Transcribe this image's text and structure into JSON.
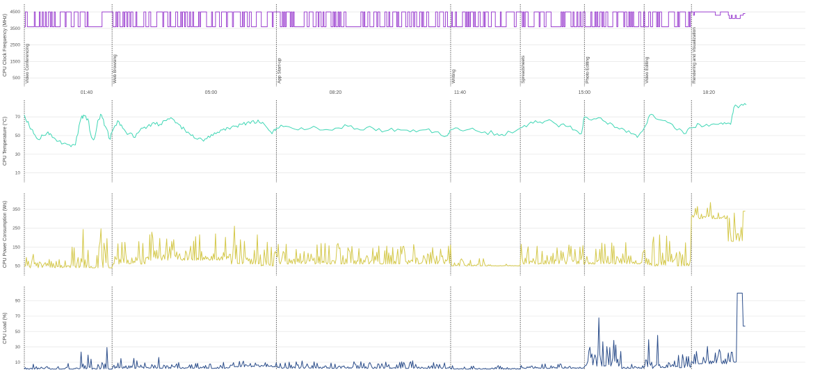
{
  "chart_data": [
    {
      "type": "line",
      "ylabel": "CPU Clock Frequency (MHz)",
      "yticks": [
        500,
        1500,
        2500,
        3500,
        4500
      ],
      "ylim": [
        0,
        4800
      ],
      "xlim": [
        0,
        1255
      ],
      "xticks": [
        {
          "t": 100,
          "label": "01:40"
        },
        {
          "t": 300,
          "label": "05:00"
        },
        {
          "t": 500,
          "label": "08:20"
        },
        {
          "t": 700,
          "label": "11:40"
        },
        {
          "t": 900,
          "label": "15:00"
        },
        {
          "t": 1100,
          "label": "18:20"
        }
      ],
      "phases": [
        {
          "t": 0,
          "label": "Video Conferencing"
        },
        {
          "t": 141,
          "label": "Web Browsing"
        },
        {
          "t": 405,
          "label": "App Start-up"
        },
        {
          "t": 685,
          "label": "Writing"
        },
        {
          "t": 797,
          "label": "Spreadsheets"
        },
        {
          "t": 900,
          "label": "Photo Editing"
        },
        {
          "t": 996,
          "label": "Video Editing"
        },
        {
          "t": 1072,
          "label": "Rendering and Visualization"
        }
      ],
      "color": "#9b3fcf",
      "series": [
        {
          "profile": [
            [
              0,
              3600,
              4500,
              0.85
            ],
            [
              100,
              4500,
              4500,
              0
            ],
            [
              102,
              3600,
              3600,
              0
            ],
            [
              124,
              4500,
              4500,
              0
            ],
            [
              141,
              3600,
              4500,
              0.8
            ],
            [
              405,
              3600,
              4500,
              0.85
            ],
            [
              685,
              3600,
              4500,
              0.75
            ],
            [
              797,
              3600,
              4500,
              0.8
            ],
            [
              900,
              3600,
              4500,
              0.85
            ],
            [
              996,
              3600,
              4500,
              0.8
            ],
            [
              1072,
              4300,
              4500,
              0.5
            ],
            [
              1130,
              4100,
              4300,
              0.6
            ],
            [
              1160,
              4300,
              4400,
              0.3
            ],
            [
              1155,
              4300,
              4400,
              0
            ]
          ]
        }
      ]
    },
    {
      "type": "line",
      "ylabel": "CPU Temperature (°C)",
      "yticks": [
        10,
        30,
        50,
        70
      ],
      "ylim": [
        0,
        85
      ],
      "xlim": [
        0,
        1255
      ],
      "color": "#3ed6b4",
      "series": [
        {
          "points": [
            [
              0,
              72
            ],
            [
              8,
              60
            ],
            [
              15,
              52
            ],
            [
              22,
              46
            ],
            [
              30,
              50
            ],
            [
              38,
              54
            ],
            [
              45,
              48
            ],
            [
              55,
              44
            ],
            [
              65,
              42
            ],
            [
              75,
              38
            ],
            [
              82,
              40
            ],
            [
              90,
              66
            ],
            [
              95,
              72
            ],
            [
              102,
              68
            ],
            [
              108,
              48
            ],
            [
              112,
              46
            ],
            [
              118,
              66
            ],
            [
              124,
              72
            ],
            [
              130,
              60
            ],
            [
              138,
              46
            ],
            [
              141,
              54
            ],
            [
              150,
              66
            ],
            [
              158,
              58
            ],
            [
              168,
              52
            ],
            [
              178,
              48
            ],
            [
              188,
              58
            ],
            [
              198,
              60
            ],
            [
              208,
              64
            ],
            [
              218,
              62
            ],
            [
              228,
              66
            ],
            [
              238,
              68
            ],
            [
              248,
              62
            ],
            [
              258,
              56
            ],
            [
              268,
              50
            ],
            [
              278,
              46
            ],
            [
              288,
              44
            ],
            [
              298,
              48
            ],
            [
              308,
              52
            ],
            [
              318,
              56
            ],
            [
              328,
              58
            ],
            [
              338,
              60
            ],
            [
              348,
              62
            ],
            [
              358,
              64
            ],
            [
              368,
              66
            ],
            [
              378,
              64
            ],
            [
              388,
              60
            ],
            [
              398,
              52
            ],
            [
              405,
              58
            ],
            [
              420,
              60
            ],
            [
              440,
              56
            ],
            [
              460,
              58
            ],
            [
              480,
              56
            ],
            [
              500,
              58
            ],
            [
              520,
              60
            ],
            [
              540,
              56
            ],
            [
              560,
              58
            ],
            [
              580,
              55
            ],
            [
              600,
              57
            ],
            [
              620,
              54
            ],
            [
              640,
              56
            ],
            [
              660,
              54
            ],
            [
              680,
              50
            ],
            [
              685,
              56
            ],
            [
              700,
              56
            ],
            [
              720,
              58
            ],
            [
              740,
              54
            ],
            [
              760,
              52
            ],
            [
              770,
              50
            ],
            [
              780,
              54
            ],
            [
              797,
              58
            ],
            [
              810,
              62
            ],
            [
              825,
              64
            ],
            [
              840,
              66
            ],
            [
              855,
              62
            ],
            [
              870,
              60
            ],
            [
              885,
              56
            ],
            [
              895,
              52
            ],
            [
              900,
              70
            ],
            [
              915,
              68
            ],
            [
              930,
              66
            ],
            [
              945,
              62
            ],
            [
              960,
              58
            ],
            [
              975,
              52
            ],
            [
              985,
              48
            ],
            [
              996,
              58
            ],
            [
              1005,
              72
            ],
            [
              1015,
              68
            ],
            [
              1030,
              66
            ],
            [
              1045,
              58
            ],
            [
              1060,
              52
            ],
            [
              1072,
              58
            ],
            [
              1085,
              62
            ],
            [
              1100,
              60
            ],
            [
              1115,
              62
            ],
            [
              1125,
              64
            ],
            [
              1135,
              62
            ],
            [
              1140,
              80
            ],
            [
              1150,
              82
            ],
            [
              1160,
              83
            ]
          ]
        }
      ]
    },
    {
      "type": "line",
      "ylabel": "CPU Power Consumption (Ws)",
      "yticks": [
        50,
        150,
        250,
        350
      ],
      "ylim": [
        0,
        420
      ],
      "xlim": [
        0,
        1255
      ],
      "color": "#d4c84a",
      "series": [
        {
          "profile": [
            [
              0,
              40,
              160,
              0.4
            ],
            [
              85,
              40,
              250,
              0.5
            ],
            [
              110,
              40,
              40,
              0
            ],
            [
              115,
              40,
              250,
              0.5
            ],
            [
              135,
              40,
              40,
              0
            ],
            [
              141,
              60,
              200,
              0.6
            ],
            [
              200,
              80,
              230,
              0.7
            ],
            [
              330,
              60,
              270,
              0.6
            ],
            [
              380,
              50,
              180,
              0.6
            ],
            [
              405,
              60,
              170,
              0.8
            ],
            [
              685,
              50,
              90,
              0.4
            ],
            [
              740,
              50,
              60,
              0.3
            ],
            [
              797,
              60,
              170,
              0.7
            ],
            [
              900,
              60,
              180,
              0.7
            ],
            [
              996,
              50,
              220,
              0.5
            ],
            [
              1072,
              300,
              400,
              0.6
            ],
            [
              1130,
              180,
              350,
              0.5
            ],
            [
              1160,
              170,
              340,
              0.4
            ],
            [
              1155,
              170,
              340,
              0
            ]
          ]
        }
      ]
    },
    {
      "type": "line",
      "ylabel": "CPU Load (%)",
      "yticks": [
        10,
        30,
        50,
        70,
        90
      ],
      "ylim": [
        0,
        105
      ],
      "xlim": [
        0,
        1255
      ],
      "color": "#2b4d8a",
      "series": [
        {
          "profile": [
            [
              0,
              1,
              10,
              0.5
            ],
            [
              88,
              1,
              40,
              0.4
            ],
            [
              108,
              1,
              5,
              0.3
            ],
            [
              118,
              1,
              40,
              0.4
            ],
            [
              135,
              1,
              3,
              0.3
            ],
            [
              141,
              2,
              16,
              0.6
            ],
            [
              200,
              2,
              22,
              0.5
            ],
            [
              240,
              2,
              10,
              0.5
            ],
            [
              330,
              4,
              14,
              0.6
            ],
            [
              405,
              2,
              12,
              0.6
            ],
            [
              685,
              1,
              6,
              0.5
            ],
            [
              797,
              2,
              8,
              0.6
            ],
            [
              900,
              5,
              68,
              0.5
            ],
            [
              960,
              2,
              10,
              0.5
            ],
            [
              996,
              2,
              58,
              0.4
            ],
            [
              1020,
              3,
              22,
              0.5
            ],
            [
              1072,
              8,
              32,
              0.6
            ],
            [
              1130,
              10,
              25,
              0.6
            ],
            [
              1145,
              100,
              100,
              0
            ],
            [
              1160,
              57,
              57,
              0
            ],
            [
              1155,
              57,
              57,
              0
            ]
          ]
        }
      ]
    }
  ]
}
